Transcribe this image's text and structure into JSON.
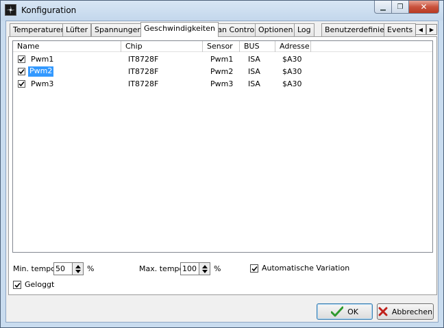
{
  "window": {
    "title": "Konfiguration"
  },
  "tabs": [
    "Temperaturen",
    "Lüfter",
    "Spannungen",
    "Geschwindigkeiten",
    "Fan Control",
    "Optionen",
    "Log",
    "Benutzerdefiniert",
    "Events"
  ],
  "active_tab": "Geschwindigkeiten",
  "list": {
    "columns": [
      "Name",
      "Chip",
      "Sensor",
      "BUS",
      "Adresse"
    ],
    "rows": [
      {
        "checked": true,
        "name": "Pwm1",
        "chip": "IT8728F",
        "sensor": "Pwm1",
        "bus": "ISA",
        "address": "$A30",
        "selected": false
      },
      {
        "checked": true,
        "name": "Pwm2",
        "chip": "IT8728F",
        "sensor": "Pwm2",
        "bus": "ISA",
        "address": "$A30",
        "selected": true
      },
      {
        "checked": true,
        "name": "Pwm3",
        "chip": "IT8728F",
        "sensor": "Pwm3",
        "bus": "ISA",
        "address": "$A30",
        "selected": false
      }
    ]
  },
  "options": {
    "min_tempo_label": "Min. tempo",
    "min_tempo_value": "50",
    "min_tempo_unit": "%",
    "max_tempo_label": "Max. tempo",
    "max_tempo_value": "100",
    "max_tempo_unit": "%",
    "auto_variation_label": "Automatische Variation",
    "auto_variation_checked": true,
    "logged_label": "Geloggt",
    "logged_checked": true
  },
  "buttons": {
    "ok": "OK",
    "cancel": "Abbrechen"
  },
  "colors": {
    "selection": "#3399ff",
    "ok_icon": "#2e9a2e",
    "cancel_icon": "#c0201a"
  }
}
